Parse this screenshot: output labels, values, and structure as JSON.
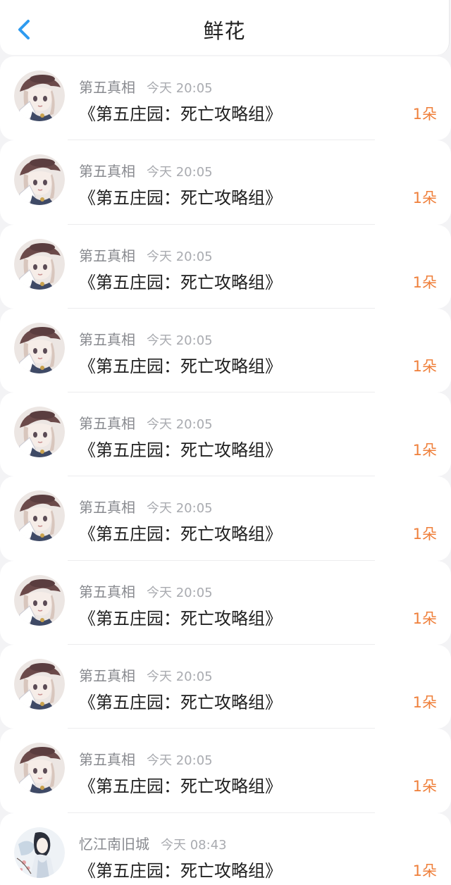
{
  "header": {
    "title": "鲜花",
    "back_icon": "chevron-left-icon",
    "accent_color": "#2e9bf0"
  },
  "list": {
    "items": [
      {
        "name": "第五真相",
        "time": "今天 20:05",
        "book": "《第五庄园：死亡攻略组》",
        "count": "1朵",
        "avatar": "anime-girl-avatar"
      },
      {
        "name": "第五真相",
        "time": "今天 20:05",
        "book": "《第五庄园：死亡攻略组》",
        "count": "1朵",
        "avatar": "anime-girl-avatar"
      },
      {
        "name": "第五真相",
        "time": "今天 20:05",
        "book": "《第五庄园：死亡攻略组》",
        "count": "1朵",
        "avatar": "anime-girl-avatar"
      },
      {
        "name": "第五真相",
        "time": "今天 20:05",
        "book": "《第五庄园：死亡攻略组》",
        "count": "1朵",
        "avatar": "anime-girl-avatar"
      },
      {
        "name": "第五真相",
        "time": "今天 20:05",
        "book": "《第五庄园：死亡攻略组》",
        "count": "1朵",
        "avatar": "anime-girl-avatar"
      },
      {
        "name": "第五真相",
        "time": "今天 20:05",
        "book": "《第五庄园：死亡攻略组》",
        "count": "1朵",
        "avatar": "anime-girl-avatar"
      },
      {
        "name": "第五真相",
        "time": "今天 20:05",
        "book": "《第五庄园：死亡攻略组》",
        "count": "1朵",
        "avatar": "anime-girl-avatar"
      },
      {
        "name": "第五真相",
        "time": "今天 20:05",
        "book": "《第五庄园：死亡攻略组》",
        "count": "1朵",
        "avatar": "anime-girl-avatar"
      },
      {
        "name": "第五真相",
        "time": "今天 20:05",
        "book": "《第五庄园：死亡攻略组》",
        "count": "1朵",
        "avatar": "anime-girl-avatar"
      },
      {
        "name": "忆江南旧城",
        "time": "今天 08:43",
        "book": "《第五庄园：死亡攻略组》",
        "count": "1朵",
        "avatar": "ink-painting-avatar"
      }
    ]
  },
  "colors": {
    "count": "#ef7f3a",
    "name": "#888a8f",
    "time": "#a9abb0",
    "book_title": "#202020",
    "background": "#f3f3f5"
  }
}
